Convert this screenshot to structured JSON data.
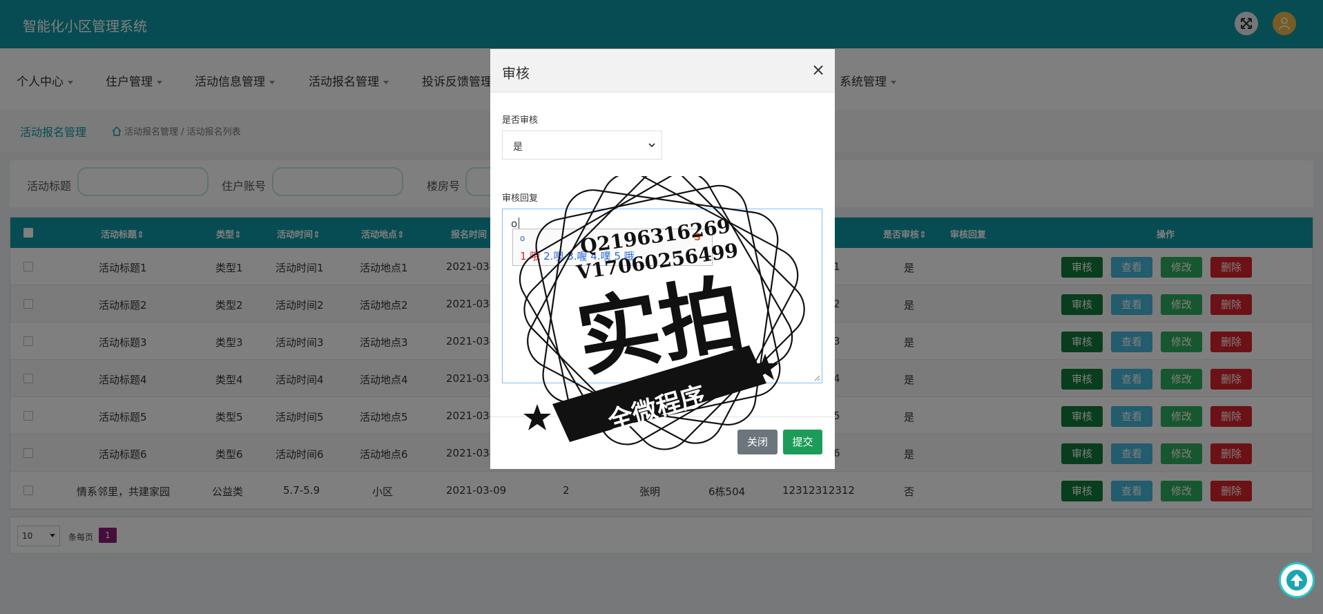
{
  "app": {
    "title": "智能化小区管理系统"
  },
  "nav": {
    "items": [
      "个人中心",
      "住户管理",
      "活动信息管理",
      "活动报名管理",
      "投诉反馈管理",
      "系统管理"
    ]
  },
  "breadcrumb": {
    "title": "活动报名管理",
    "path": "活动报名管理 / 活动报名列表"
  },
  "search": {
    "labels": [
      "活动标题",
      "住户账号",
      "楼房号"
    ]
  },
  "table": {
    "headers": [
      "活动标题⇕",
      "类型⇕",
      "活动时间⇕",
      "活动地点⇕",
      "报名时间",
      "是否审核⇕",
      "审核回复",
      "操作"
    ],
    "rows": [
      [
        "活动标题1",
        "类型1",
        "活动时间1",
        "活动地点1",
        "2021-03-",
        "1",
        "是"
      ],
      [
        "活动标题2",
        "类型2",
        "活动时间2",
        "活动地点2",
        "2021-03-",
        "2",
        "是"
      ],
      [
        "活动标题3",
        "类型3",
        "活动时间3",
        "活动地点3",
        "2021-03-",
        "3",
        "是"
      ],
      [
        "活动标题4",
        "类型4",
        "活动时间4",
        "活动地点4",
        "2021-03-",
        "4",
        "是"
      ],
      [
        "活动标题5",
        "类型5",
        "活动时间5",
        "活动地点5",
        "2021-03-",
        "5",
        "是"
      ],
      [
        "活动标题6",
        "类型6",
        "活动时间6",
        "活动地点6",
        "2021-03-",
        "6",
        "是"
      ]
    ],
    "last_row": [
      "情系邻里，共建家园",
      "公益类",
      "5.7-5.9",
      "小区",
      "2021-03-09",
      "2",
      "张明",
      "6栋504",
      "12312312312",
      "否"
    ],
    "actions": [
      "审核",
      "查看",
      "修改",
      "删除"
    ]
  },
  "pager": {
    "page_size": "10",
    "per_page_label": "条每页",
    "current": "1"
  },
  "modal": {
    "title": "审核",
    "close_symbol": "×",
    "field1_label": "是否审核",
    "field1_value": "是",
    "field2_label": "审核回复",
    "field2_value": "o",
    "close_button": "关闭",
    "submit_button": "提交"
  },
  "ime": {
    "input": "o",
    "candidates": [
      "1.哦",
      "2.噢",
      "3.喔",
      "4.噗",
      "5.哦"
    ],
    "logo": "S"
  },
  "watermark": {
    "line1": "Q2196316269",
    "line2": "V17060256499",
    "big": "实拍",
    "banner": "全微程序"
  },
  "colors": {
    "primary": "#0f98a5",
    "audit": "#117a3a",
    "view": "#46b8da",
    "edit": "#2fae5f",
    "delete": "#d9232d",
    "pager_active": "#8e1b7a"
  }
}
